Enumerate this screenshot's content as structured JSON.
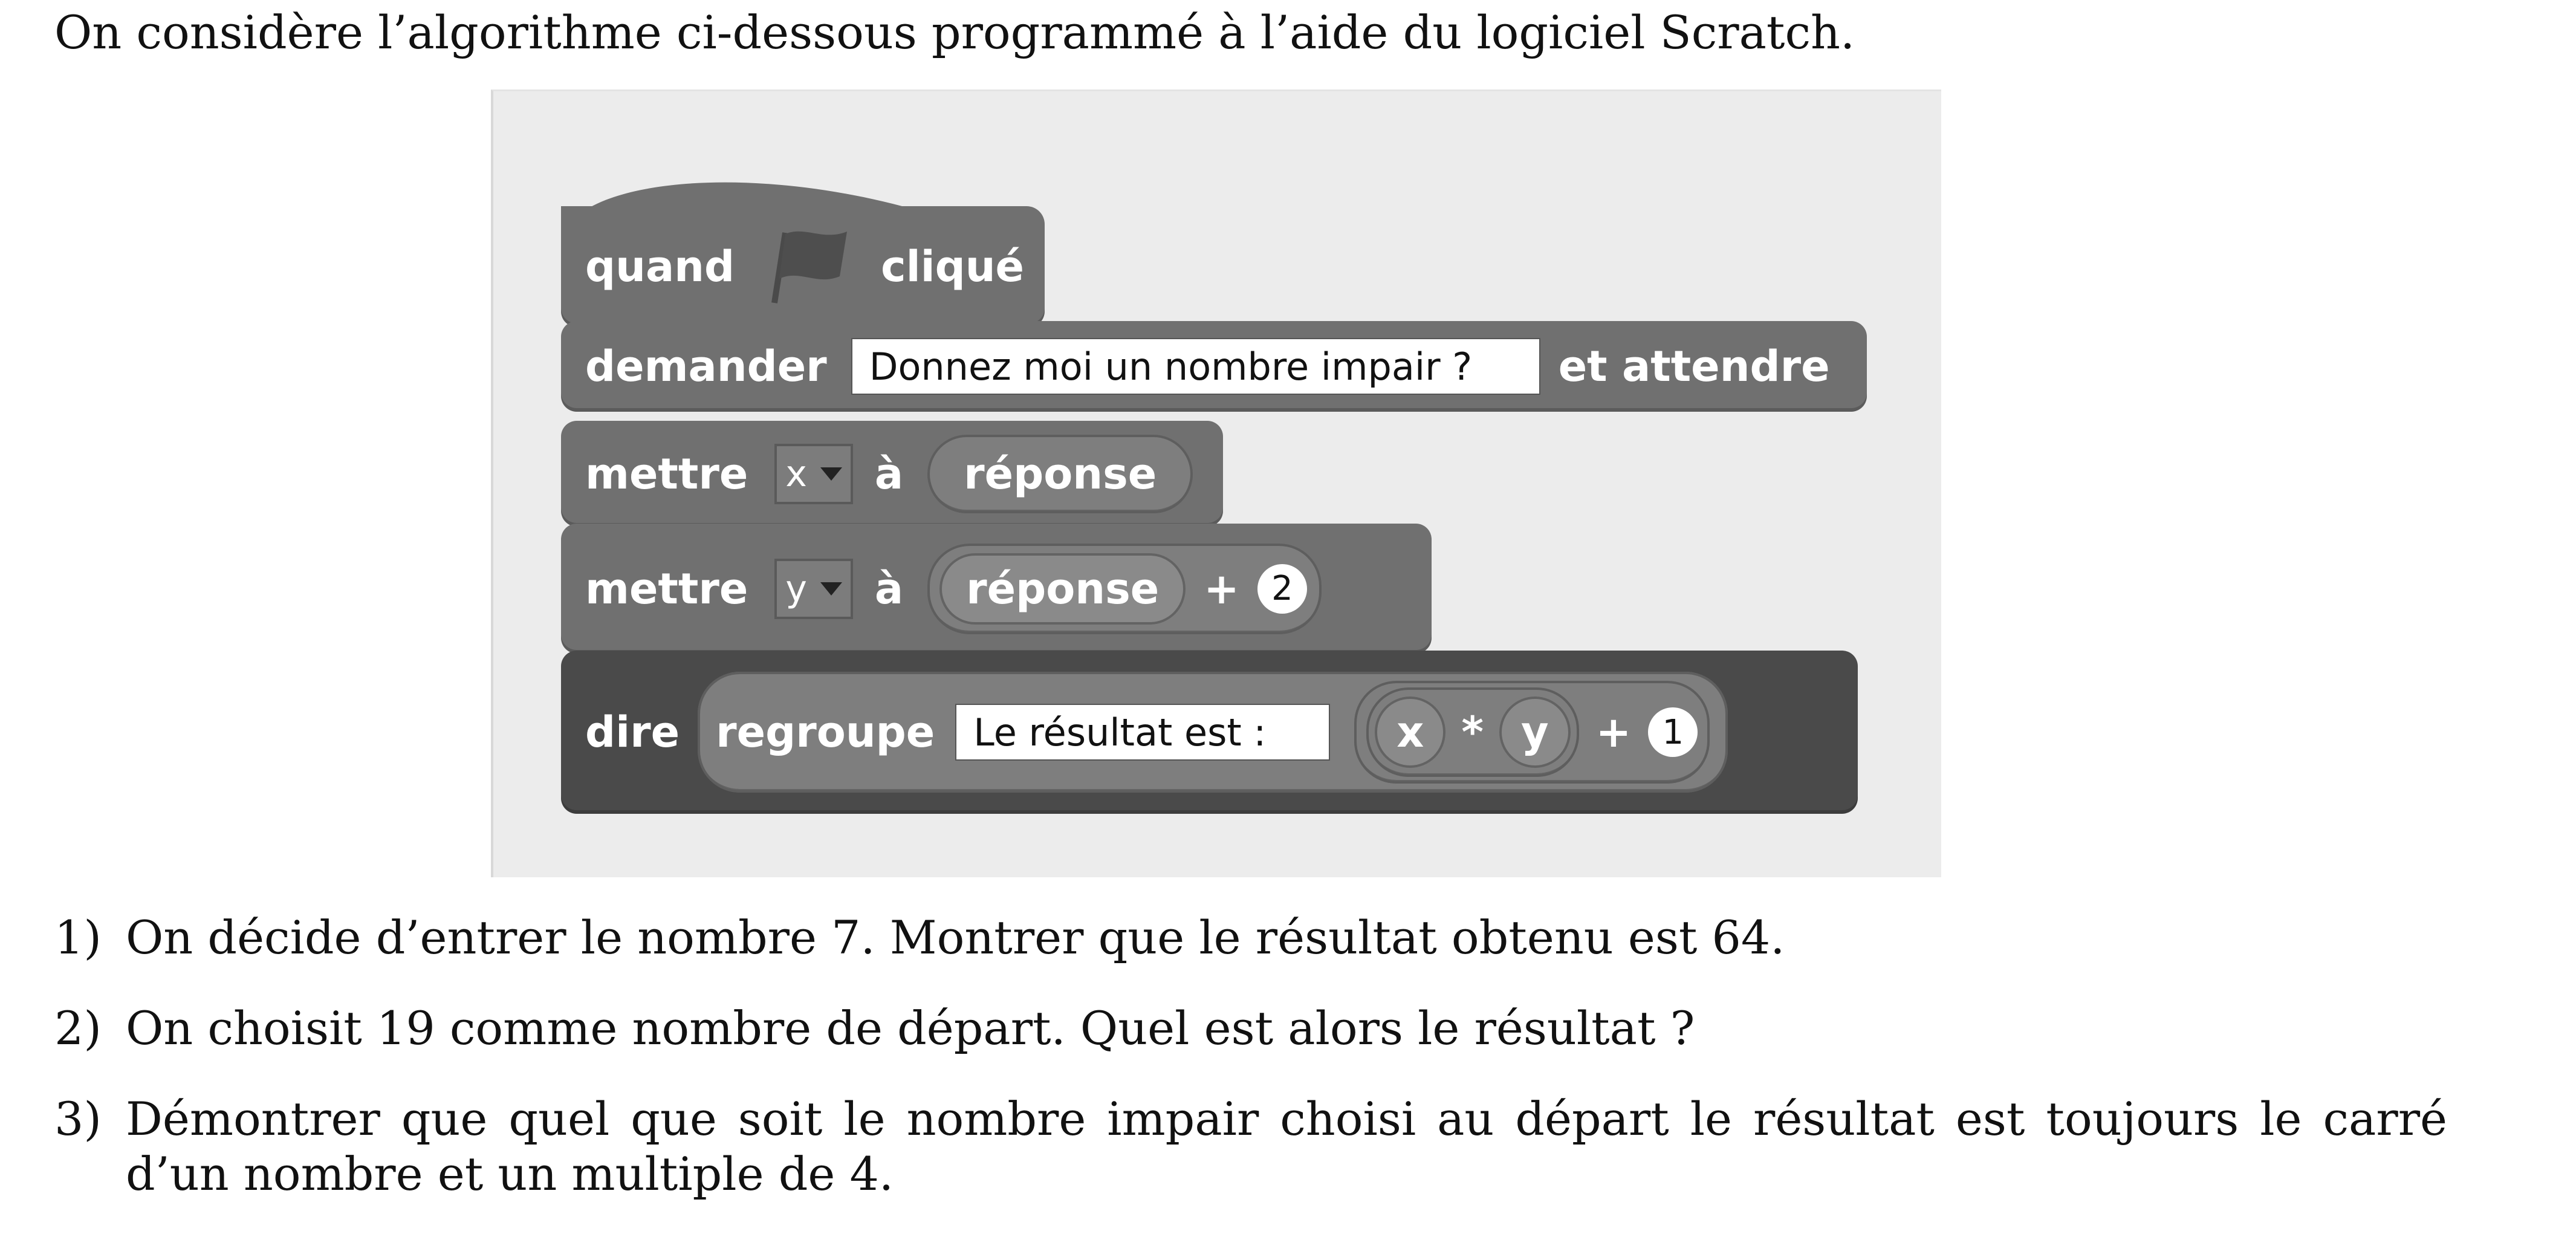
{
  "intro": "On considère l’algorithme ci-dessous programmé à l’aide du logiciel Scratch.",
  "scratch": {
    "hat": {
      "when": "quand",
      "flag_icon": "green-flag-icon",
      "clicked": "cliqué"
    },
    "ask": {
      "label": "demander",
      "prompt": "Donnez moi un nombre impair ?",
      "suffix": "et attendre"
    },
    "set_x": {
      "label": "mettre",
      "variable": "x",
      "to": "à",
      "value": "réponse"
    },
    "set_y": {
      "label": "mettre",
      "variable": "y",
      "to": "à",
      "value": "réponse",
      "plus": "+",
      "addend": "2"
    },
    "say": {
      "label": "dire",
      "join": "regroupe",
      "text": "Le résultat est :",
      "x": "x",
      "times": "*",
      "y": "y",
      "plus": "+",
      "addend": "1"
    }
  },
  "questions": [
    {
      "number": "1)",
      "text": "On décide d’entrer le nombre 7. Montrer que le résultat obtenu est 64."
    },
    {
      "number": "2)",
      "text": "On choisit 19 comme nombre de départ. Quel est alors le résultat ?"
    },
    {
      "number": "3)",
      "text": "Démontrer que quel que soit le nombre impair choisi au départ le résultat est toujours le carré d’un nombre et un multiple de 4."
    }
  ]
}
